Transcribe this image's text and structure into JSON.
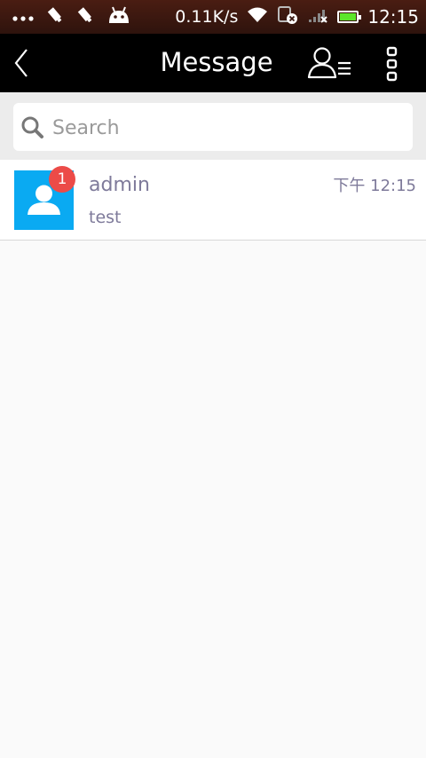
{
  "status_bar": {
    "network_speed": "0.11K/s",
    "time": "12:15",
    "icons": [
      "more-dots-icon",
      "usb-debug-icon",
      "usb-debug-icon",
      "android-icon",
      "wifi-icon",
      "sim-error-icon",
      "signal-icon",
      "battery-icon"
    ],
    "battery_level": 0.86,
    "battery_color": "#5ce62a"
  },
  "title_bar": {
    "title": "Message",
    "back_icon": "chevron-left-icon",
    "contacts_icon": "contact-list-icon",
    "more_icon": "more-vertical-icon"
  },
  "search": {
    "placeholder": "Search",
    "icon": "search-icon"
  },
  "conversations": [
    {
      "name": "admin",
      "preview": "test",
      "time": "下午 12:15",
      "unread": "1",
      "avatar_color": "#0aaaf2",
      "badge_color": "#ec4b48"
    }
  ]
}
